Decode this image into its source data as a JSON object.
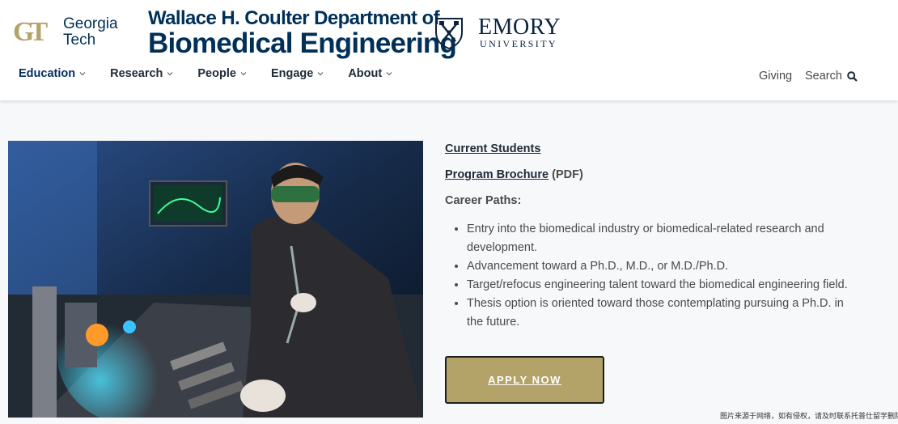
{
  "header": {
    "gt_logo": {
      "mark": "GT",
      "line1": "Georgia",
      "line2": "Tech"
    },
    "dept": {
      "line1": "Wallace H. Coulter Department of",
      "line2": "Biomedical Engineering"
    },
    "emory": {
      "name": "EMORY",
      "sub": "UNIVERSITY"
    }
  },
  "nav": {
    "items": [
      {
        "label": "Education"
      },
      {
        "label": "Research"
      },
      {
        "label": "People"
      },
      {
        "label": "Engage"
      },
      {
        "label": "About"
      }
    ],
    "giving_label": "Giving",
    "search_label": "Search"
  },
  "main": {
    "current_students": "Current Students",
    "program_brochure": "Program Brochure",
    "pdf_suffix": "(PDF)",
    "career_paths": "Career Paths:",
    "bullets": [
      "Entry into the biomedical industry or biomedical-related research and development.",
      "Advancement toward a Ph.D., M.D., or M.D./Ph.D.",
      "Target/refocus engineering talent toward the biomedical engineering field.",
      "Thesis option is oriented toward those contemplating pursuing a Ph.D. in the future."
    ],
    "apply_label": "APPLY NOW"
  },
  "watermark": "图片来源于网络，如有侵权，请及时联系托普仕留学删除",
  "colors": {
    "gold": "#b3a369",
    "navy": "#003057",
    "emory_navy": "#0c2340"
  }
}
